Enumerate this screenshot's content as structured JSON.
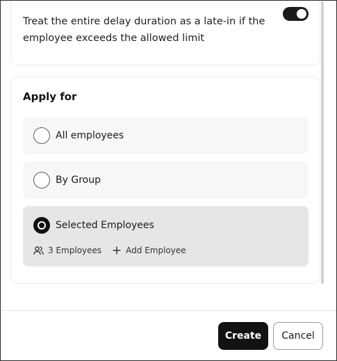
{
  "late_in": {
    "text": "Treat the entire delay duration as a late-in if the employee exceeds the allowed limit",
    "toggle_on": true
  },
  "apply_for": {
    "title": "Apply for",
    "options": [
      {
        "label": "All employees",
        "selected": false
      },
      {
        "label": "By Group",
        "selected": false
      },
      {
        "label": "Selected Employees",
        "selected": true
      }
    ],
    "employees_count_label": "3 Employees",
    "add_employee_label": "Add Employee"
  },
  "footer": {
    "create_label": "Create",
    "cancel_label": "Cancel"
  },
  "colors": {
    "primary": "#121212",
    "option_bg": "#f7f7f7",
    "option_selected_bg": "#e6e6e6"
  }
}
